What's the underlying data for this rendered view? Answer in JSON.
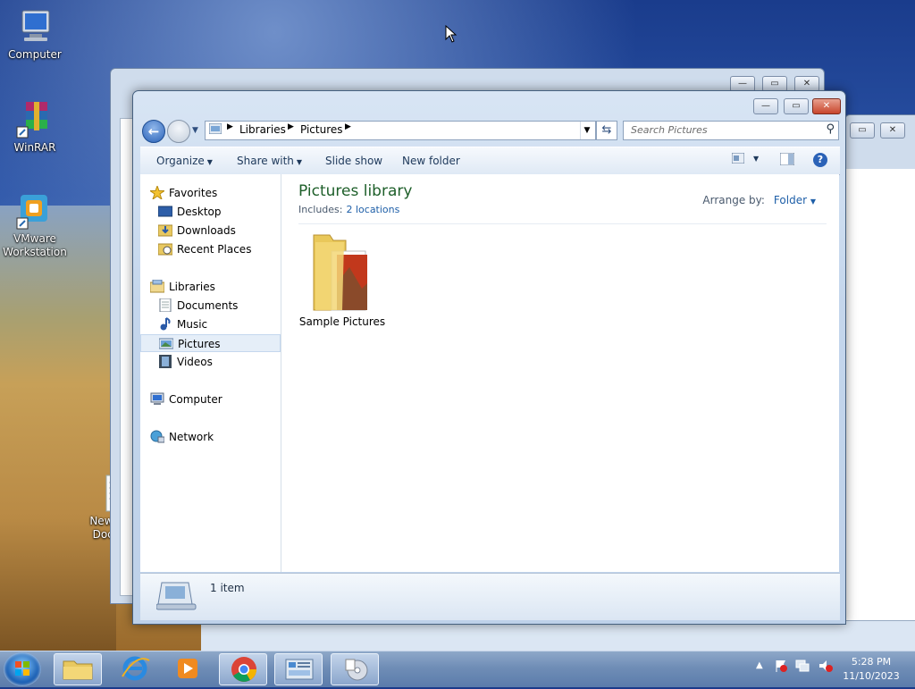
{
  "desktop": {
    "icons": [
      {
        "label": "Computer"
      },
      {
        "label": "WinRAR"
      },
      {
        "label_line1": "VMware",
        "label_line2": "Workstation"
      },
      {
        "label_line1": "New T",
        "label_line2": "Docu"
      }
    ]
  },
  "window": {
    "address": {
      "crumb1": "Libraries",
      "crumb2": "Pictures"
    },
    "search_placeholder": "Search Pictures",
    "toolbar": {
      "organize": "Organize",
      "share_with": "Share with",
      "slide_show": "Slide show",
      "new_folder": "New folder",
      "help": "?"
    },
    "nav": {
      "favorites": "Favorites",
      "desktop": "Desktop",
      "downloads": "Downloads",
      "recent_places": "Recent Places",
      "libraries": "Libraries",
      "documents": "Documents",
      "music": "Music",
      "pictures": "Pictures",
      "videos": "Videos",
      "computer": "Computer",
      "network": "Network"
    },
    "content": {
      "title": "Pictures library",
      "includes_label": "Includes:",
      "includes_link": "2 locations",
      "arrange_label": "Arrange by:",
      "arrange_value": "Folder",
      "items": [
        {
          "label": "Sample Pictures"
        }
      ]
    },
    "details": {
      "count": "1 item"
    }
  },
  "taskbar": {
    "time": "5:28 PM",
    "date": "11/10/2023"
  },
  "colors": {
    "library_title": "#1e5f2a",
    "link": "#1e5fa8",
    "selection": "#e5eef8"
  }
}
